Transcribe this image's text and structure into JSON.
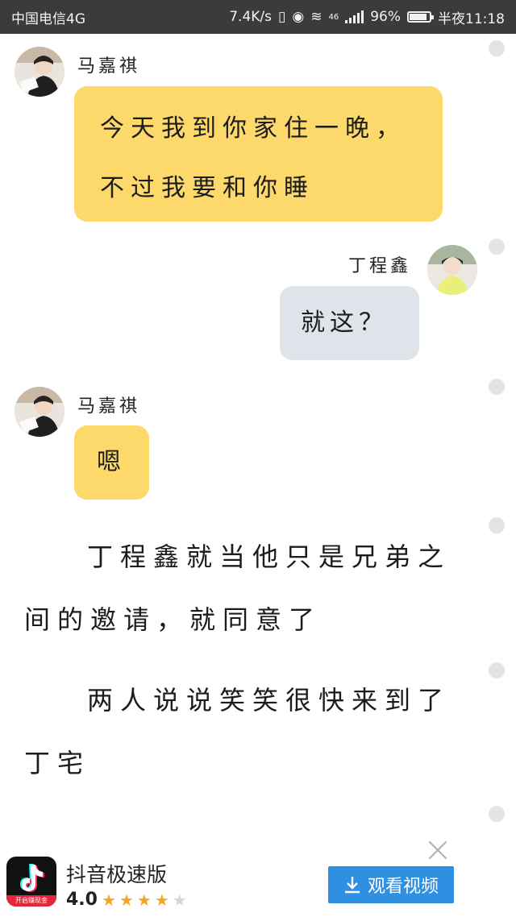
{
  "status_bar": {
    "carrier": "中国电信4G",
    "speed": "7.4K/s",
    "network": "46",
    "battery": "96%",
    "battery_level": 0.96,
    "time": "半夜11:18"
  },
  "messages": [
    {
      "sender": "马嘉祺",
      "side": "left",
      "lines": [
        "今天我到你家住一晚，",
        "不过我要和你睡"
      ]
    },
    {
      "sender": "丁程鑫",
      "side": "right",
      "lines": [
        "就这？"
      ]
    },
    {
      "sender": "马嘉祺",
      "side": "left",
      "lines": [
        "嗯"
      ]
    }
  ],
  "narration": [
    "丁程鑫就当他只是兄弟之间的邀请，就同意了",
    "两人说说笑笑很快来到了丁宅"
  ],
  "ad": {
    "app_name": "抖音极速版",
    "rating": "4.0",
    "rating_value": 4.0,
    "button_label": "观看视频",
    "icon_caption": "开启赚现金"
  },
  "colors": {
    "status_bar": "#3b3b3b",
    "bubble_left": "#fcd96a",
    "bubble_right": "#dfe3ea",
    "ad_button": "#2f8fe0",
    "star": "#f5a623"
  }
}
